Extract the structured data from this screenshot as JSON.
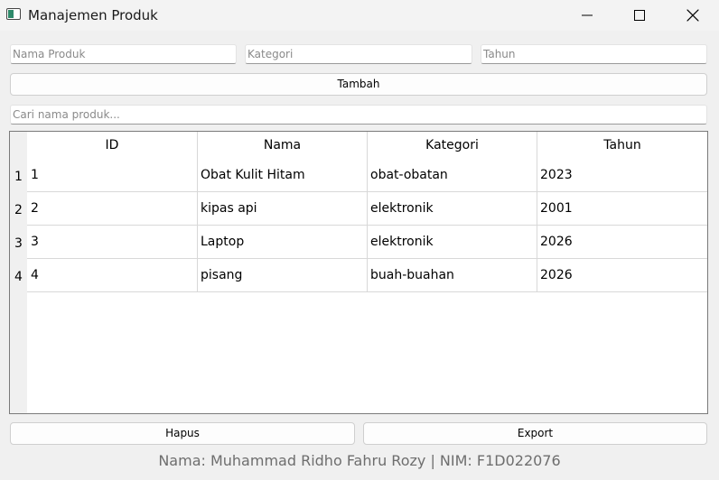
{
  "window": {
    "title": "Manajemen Produk",
    "controls": [
      "minimize-icon",
      "maximize-icon",
      "close-icon"
    ]
  },
  "form": {
    "nama_placeholder": "Nama Produk",
    "kategori_placeholder": "Kategori",
    "tahun_placeholder": "Tahun",
    "add_label": "Tambah",
    "search_placeholder": "Cari nama produk..."
  },
  "table": {
    "columns": [
      "ID",
      "Nama",
      "Kategori",
      "Tahun"
    ],
    "rows": [
      {
        "num": "1",
        "id": "1",
        "nama": "Obat Kulit Hitam",
        "kategori": "obat-obatan",
        "tahun": "2023"
      },
      {
        "num": "2",
        "id": "2",
        "nama": "kipas api",
        "kategori": "elektronik",
        "tahun": "2001"
      },
      {
        "num": "3",
        "id": "3",
        "nama": "Laptop",
        "kategori": "elektronik",
        "tahun": "2026"
      },
      {
        "num": "4",
        "id": "4",
        "nama": "pisang",
        "kategori": "buah-buahan",
        "tahun": "2026"
      }
    ]
  },
  "actions": {
    "delete_label": "Hapus",
    "export_label": "Export"
  },
  "footer": {
    "text": "Nama: Muhammad Ridho Fahru Rozy | NIM: F1D022076"
  }
}
